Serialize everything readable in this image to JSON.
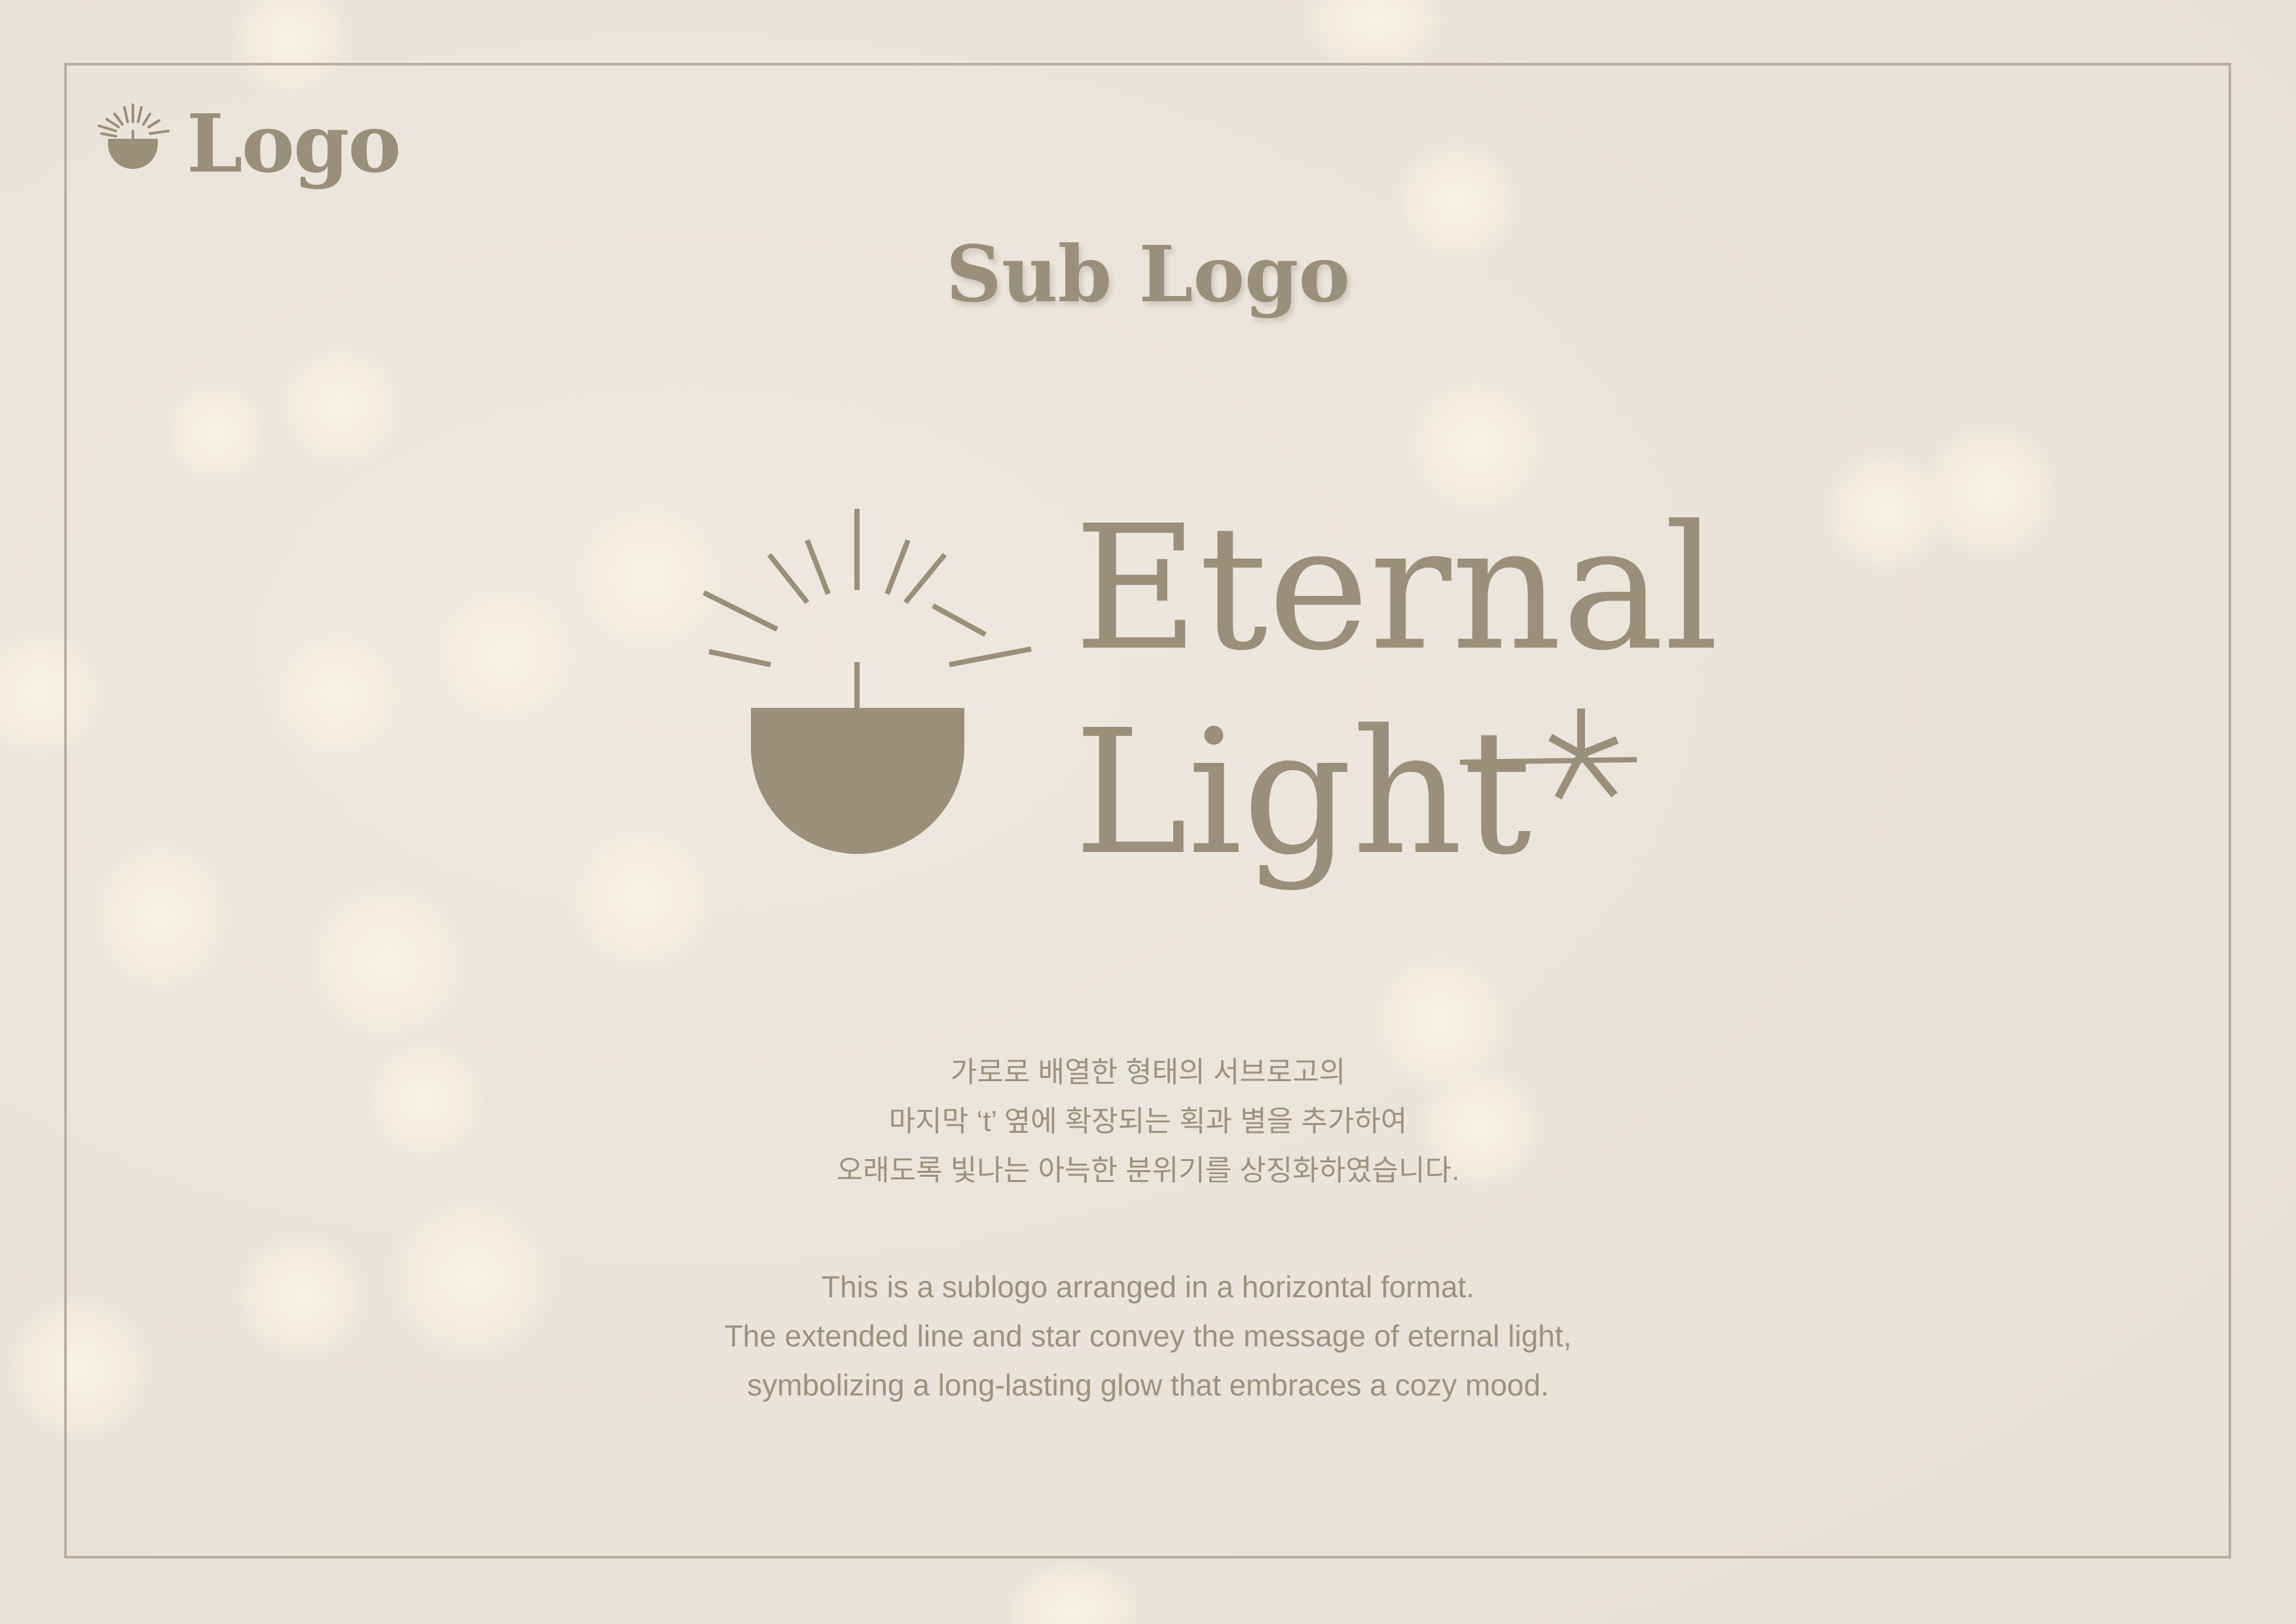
{
  "header": {
    "logo_text": "Logo",
    "logo_icon": "lamp-icon"
  },
  "title": "Sub Logo",
  "brand": {
    "line1": "Eternal",
    "line2": "Light",
    "mark_icon": "lamp-rays-icon",
    "accent_icon": "star-icon"
  },
  "description": {
    "korean": [
      "가로로 배열한 형태의 서브로고의",
      "마지막 ‘t’ 옆에 확장되는 획과 별을 추가하여",
      "오래도록 빛나는 아늑한 분위기를 상징화하였습니다."
    ],
    "english": [
      "This is a sublogo arranged in a horizontal format.",
      "The extended line and star convey the message of eternal light,",
      "symbolizing a long-lasting glow that embraces a cozy mood."
    ]
  },
  "colors": {
    "brand": "#9a8f79",
    "background": "#ebe6dd",
    "frame": "#b8afa1"
  }
}
